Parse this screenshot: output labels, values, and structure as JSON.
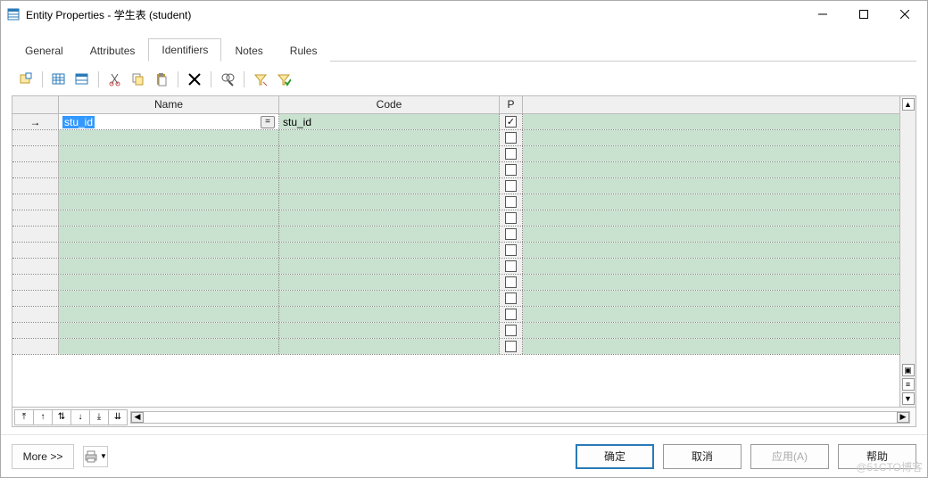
{
  "window": {
    "title": "Entity Properties - 学生表 (student)"
  },
  "tabs": [
    {
      "id": "general",
      "label": "General",
      "active": false
    },
    {
      "id": "attributes",
      "label": "Attributes",
      "active": false
    },
    {
      "id": "identifiers",
      "label": "Identifiers",
      "active": true
    },
    {
      "id": "notes",
      "label": "Notes",
      "active": false
    },
    {
      "id": "rules",
      "label": "Rules",
      "active": false
    }
  ],
  "toolbar_icons": [
    "properties-icon",
    "sep",
    "grid-icon",
    "grid2-icon",
    "sep",
    "cut-icon",
    "copy-icon",
    "paste-icon",
    "sep",
    "delete-icon",
    "sep",
    "find-icon",
    "sep",
    "sort-asc-icon",
    "sort-desc-icon"
  ],
  "grid": {
    "columns": {
      "name": "Name",
      "code": "Code",
      "p": "P"
    },
    "rows": [
      {
        "current": true,
        "name": "stu_id",
        "name_selected": true,
        "has_eq_button": true,
        "code": "stu_id",
        "p": true
      },
      {
        "current": false,
        "name": "",
        "code": "",
        "p": false
      },
      {
        "current": false,
        "name": "",
        "code": "",
        "p": false
      },
      {
        "current": false,
        "name": "",
        "code": "",
        "p": false
      },
      {
        "current": false,
        "name": "",
        "code": "",
        "p": false
      },
      {
        "current": false,
        "name": "",
        "code": "",
        "p": false
      },
      {
        "current": false,
        "name": "",
        "code": "",
        "p": false
      },
      {
        "current": false,
        "name": "",
        "code": "",
        "p": false
      },
      {
        "current": false,
        "name": "",
        "code": "",
        "p": false
      },
      {
        "current": false,
        "name": "",
        "code": "",
        "p": false
      },
      {
        "current": false,
        "name": "",
        "code": "",
        "p": false
      },
      {
        "current": false,
        "name": "",
        "code": "",
        "p": false
      },
      {
        "current": false,
        "name": "",
        "code": "",
        "p": false
      },
      {
        "current": false,
        "name": "",
        "code": "",
        "p": false
      },
      {
        "current": false,
        "name": "",
        "code": "",
        "p": false
      }
    ],
    "nav_buttons": [
      "⤒",
      "↑",
      "⇅",
      "↓",
      "⤓",
      "⇊"
    ]
  },
  "footer": {
    "more": "More >>",
    "ok": "确定",
    "cancel": "取消",
    "apply": "应用(A)",
    "help": "帮助"
  },
  "watermark": "@51CTO博客"
}
